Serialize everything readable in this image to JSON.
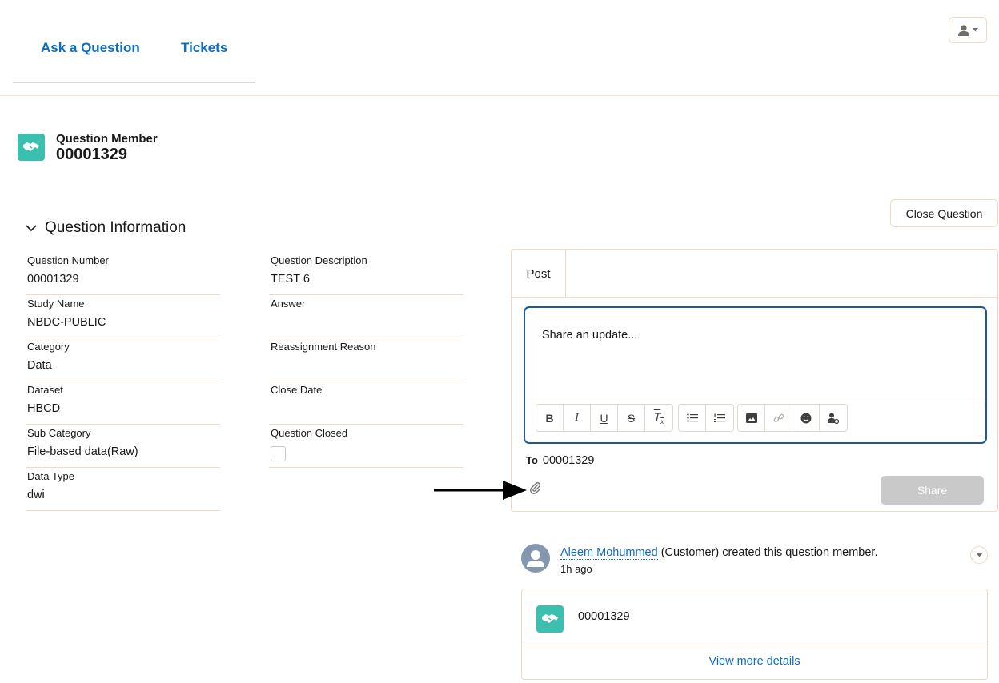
{
  "nav": {
    "ask_label": "Ask a Question",
    "tickets_label": "Tickets"
  },
  "record": {
    "type_label": "Question Member",
    "number": "00001329"
  },
  "actions": {
    "close_question_label": "Close Question"
  },
  "section": {
    "title": "Question Information",
    "fields_left": [
      {
        "label": "Question Number",
        "value": "00001329"
      },
      {
        "label": "Study Name",
        "value": "NBDC-PUBLIC"
      },
      {
        "label": "Category",
        "value": "Data"
      },
      {
        "label": "Dataset",
        "value": "HBCD"
      },
      {
        "label": "Sub Category",
        "value": "File-based data(Raw)"
      },
      {
        "label": "Data Type",
        "value": "dwi"
      }
    ],
    "fields_right": [
      {
        "label": "Question Description",
        "value": "TEST 6"
      },
      {
        "label": "Answer",
        "value": ""
      },
      {
        "label": "Reassignment Reason",
        "value": ""
      },
      {
        "label": "Close Date",
        "value": ""
      },
      {
        "label": "Question Closed",
        "value": ""
      }
    ]
  },
  "publisher": {
    "tab_label": "Post",
    "placeholder": "Share an update...",
    "to_label": "To",
    "to_value": "00001329",
    "share_label": "Share"
  },
  "feed": {
    "actor": "Aleem Mohummed",
    "action_text": " (Customer) created this question member.",
    "time": "1h ago",
    "card_number": "00001329",
    "view_more_label": "View more details"
  },
  "colors": {
    "brand_link": "#0b6dc4",
    "record_icon_bg": "#3bbfae",
    "editor_border": "#1b5aa3",
    "share_disabled": "#c9c9c9"
  }
}
